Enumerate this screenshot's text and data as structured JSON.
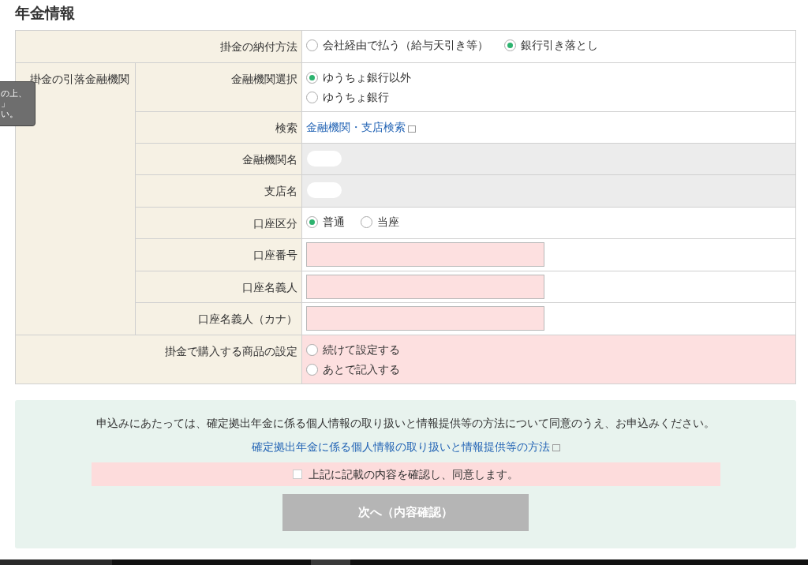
{
  "page_title": "年金情報",
  "tooltip": {
    "lines": [
      "の上、",
      "」",
      "い。"
    ]
  },
  "form": {
    "payment_method": {
      "label": "掛金の納付方法",
      "kind": "radio",
      "stacked": false,
      "invalid": false,
      "options": [
        {
          "label": "会社経由で払う（給与天引き等）",
          "selected": false
        },
        {
          "label": "銀行引き落とし",
          "selected": true
        }
      ]
    },
    "bank_group": {
      "label": "掛金の引落金融機関",
      "rows": [
        {
          "label": "金融機関選択",
          "kind": "radio",
          "stacked": true,
          "invalid": false,
          "options": [
            {
              "label": "ゆうちょ銀行以外",
              "selected": true
            },
            {
              "label": "ゆうちょ銀行",
              "selected": false
            }
          ]
        },
        {
          "label": "検索",
          "kind": "link",
          "link": "金融機関・支店検索"
        },
        {
          "label": "金融機関名",
          "kind": "readonly"
        },
        {
          "label": "支店名",
          "kind": "readonly"
        },
        {
          "label": "口座区分",
          "kind": "radio",
          "stacked": false,
          "invalid": false,
          "options": [
            {
              "label": "普通",
              "selected": true
            },
            {
              "label": "当座",
              "selected": false
            }
          ]
        },
        {
          "label": "口座番号",
          "kind": "text_input",
          "invalid": true
        },
        {
          "label": "口座名義人",
          "kind": "text_input",
          "invalid": true
        },
        {
          "label": "口座名義人（カナ）",
          "kind": "text_input",
          "invalid": true
        }
      ]
    },
    "product_setting": {
      "label": "掛金で購入する商品の設定",
      "kind": "radio",
      "stacked": true,
      "invalid": true,
      "options": [
        {
          "label": "続けて設定する",
          "selected": false
        },
        {
          "label": "あとで記入する",
          "selected": false
        }
      ]
    }
  },
  "agreement": {
    "text": "申込みにあたっては、確定拠出年金に係る個人情報の取り扱いと情報提供等の方法について同意のうえ、お申込みください。",
    "link": "確定拠出年金に係る個人情報の取り扱いと情報提供等の方法",
    "checkbox": {
      "label": "上記に記載の内容を確認し、同意します。",
      "checked": false
    },
    "button": {
      "label": "次へ（内容確認）",
      "disabled": true
    }
  }
}
